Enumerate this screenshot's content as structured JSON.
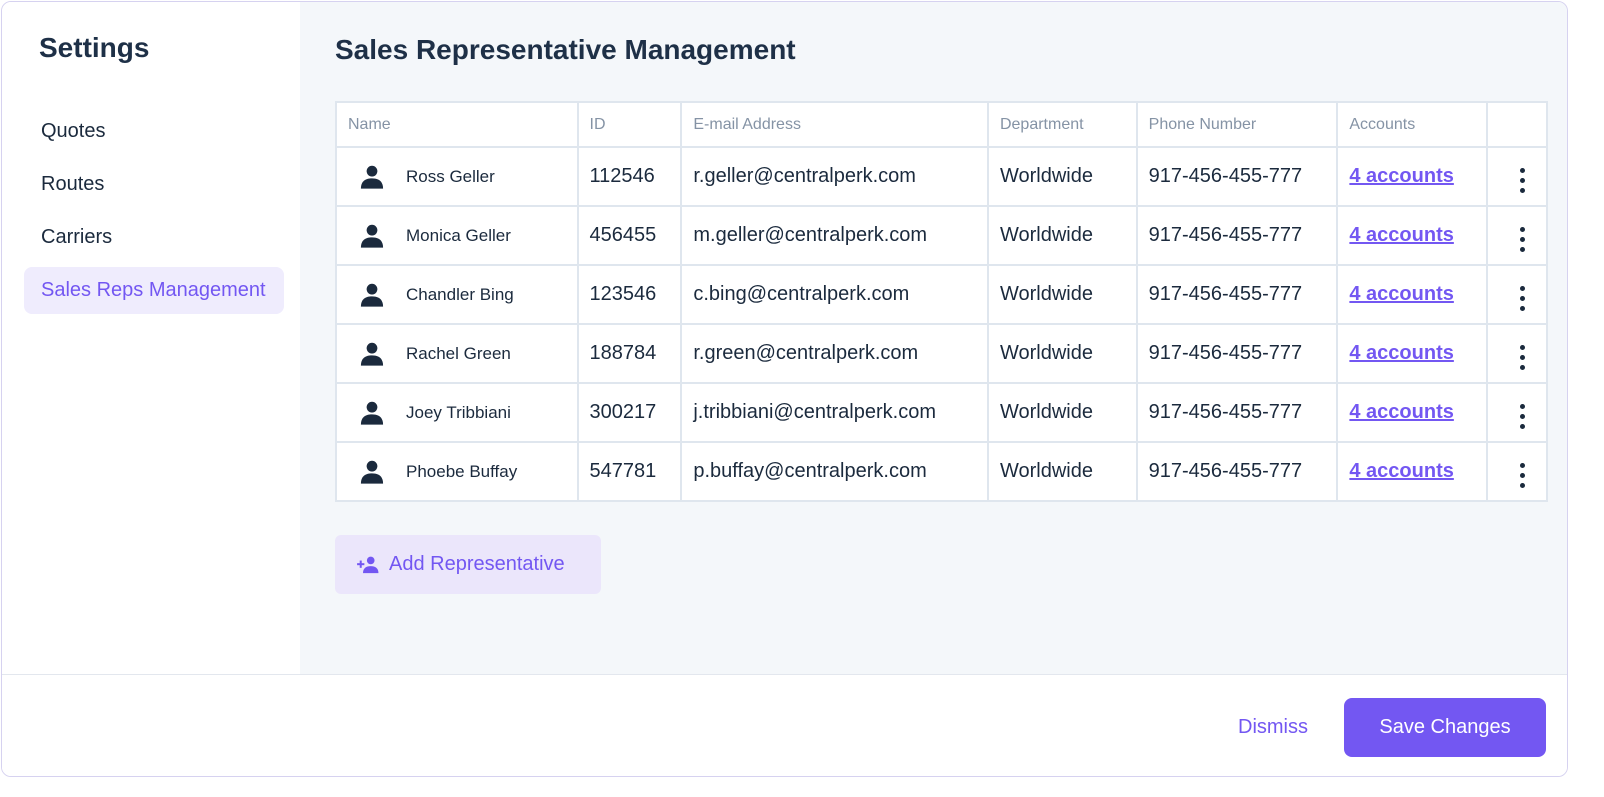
{
  "sidebar": {
    "title": "Settings",
    "items": [
      {
        "label": "Quotes"
      },
      {
        "label": "Routes"
      },
      {
        "label": "Carriers"
      },
      {
        "label": "Sales Reps Management",
        "active": true
      }
    ]
  },
  "main": {
    "title": "Sales Representative Management",
    "table": {
      "headers": {
        "name": "Name",
        "id": "ID",
        "email": "E-mail Address",
        "department": "Department",
        "phone": "Phone Number",
        "accounts": "Accounts"
      },
      "rows": [
        {
          "name": "Ross Geller",
          "id": "112546",
          "email": "r.geller@centralperk.com",
          "department": "Worldwide",
          "phone": "917-456-455-777",
          "accounts": "4 accounts"
        },
        {
          "name": "Monica Geller",
          "id": "456455",
          "email": "m.geller@centralperk.com",
          "department": "Worldwide",
          "phone": "917-456-455-777",
          "accounts": "4 accounts"
        },
        {
          "name": "Chandler Bing",
          "id": "123546",
          "email": "c.bing@centralperk.com",
          "department": "Worldwide",
          "phone": "917-456-455-777",
          "accounts": "4 accounts"
        },
        {
          "name": "Rachel Green",
          "id": "188784",
          "email": "r.green@centralperk.com",
          "department": "Worldwide",
          "phone": "917-456-455-777",
          "accounts": "4 accounts"
        },
        {
          "name": "Joey Tribbiani",
          "id": "300217",
          "email": "j.tribbiani@centralperk.com",
          "department": "Worldwide",
          "phone": "917-456-455-777",
          "accounts": "4 accounts"
        },
        {
          "name": "Phoebe Buffay",
          "id": "547781",
          "email": "p.buffay@centralperk.com",
          "department": "Worldwide",
          "phone": "917-456-455-777",
          "accounts": "4 accounts"
        }
      ]
    },
    "add_button_label": "Add Representative"
  },
  "footer": {
    "dismiss_label": "Dismiss",
    "save_label": "Save Changes"
  },
  "icons": {
    "row_icon": "person-icon",
    "add_icon": "person-add-icon",
    "row_menu_icon": "more-vertical-icon"
  },
  "colors": {
    "accent": "#7357f2",
    "accent_light": "#efecfd",
    "text_dark": "#1b2a3d",
    "header_gray": "#8593a5",
    "main_bg": "#f4f7fa"
  }
}
